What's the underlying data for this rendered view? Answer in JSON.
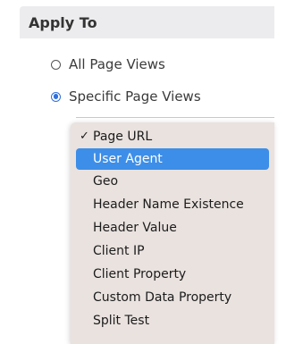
{
  "section": {
    "title": "Apply To"
  },
  "radios": {
    "all": {
      "label": "All Page Views",
      "checked": false
    },
    "specific": {
      "label": "Specific Page Views",
      "checked": true
    }
  },
  "dropdown": {
    "checked_item": "Page URL",
    "highlighted_item": "User Agent",
    "items": [
      {
        "label": "Page URL"
      },
      {
        "label": "User Agent"
      },
      {
        "label": "Geo"
      },
      {
        "label": "Header Name Existence"
      },
      {
        "label": "Header Value"
      },
      {
        "label": "Client IP"
      },
      {
        "label": "Client Property"
      },
      {
        "label": "Custom Data Property"
      },
      {
        "label": "Split Test"
      }
    ]
  },
  "icons": {
    "checkmark": "✓"
  },
  "colors": {
    "accent": "#3d8ee8",
    "header_bg": "#ececee",
    "menu_bg": "#e9e2df"
  }
}
